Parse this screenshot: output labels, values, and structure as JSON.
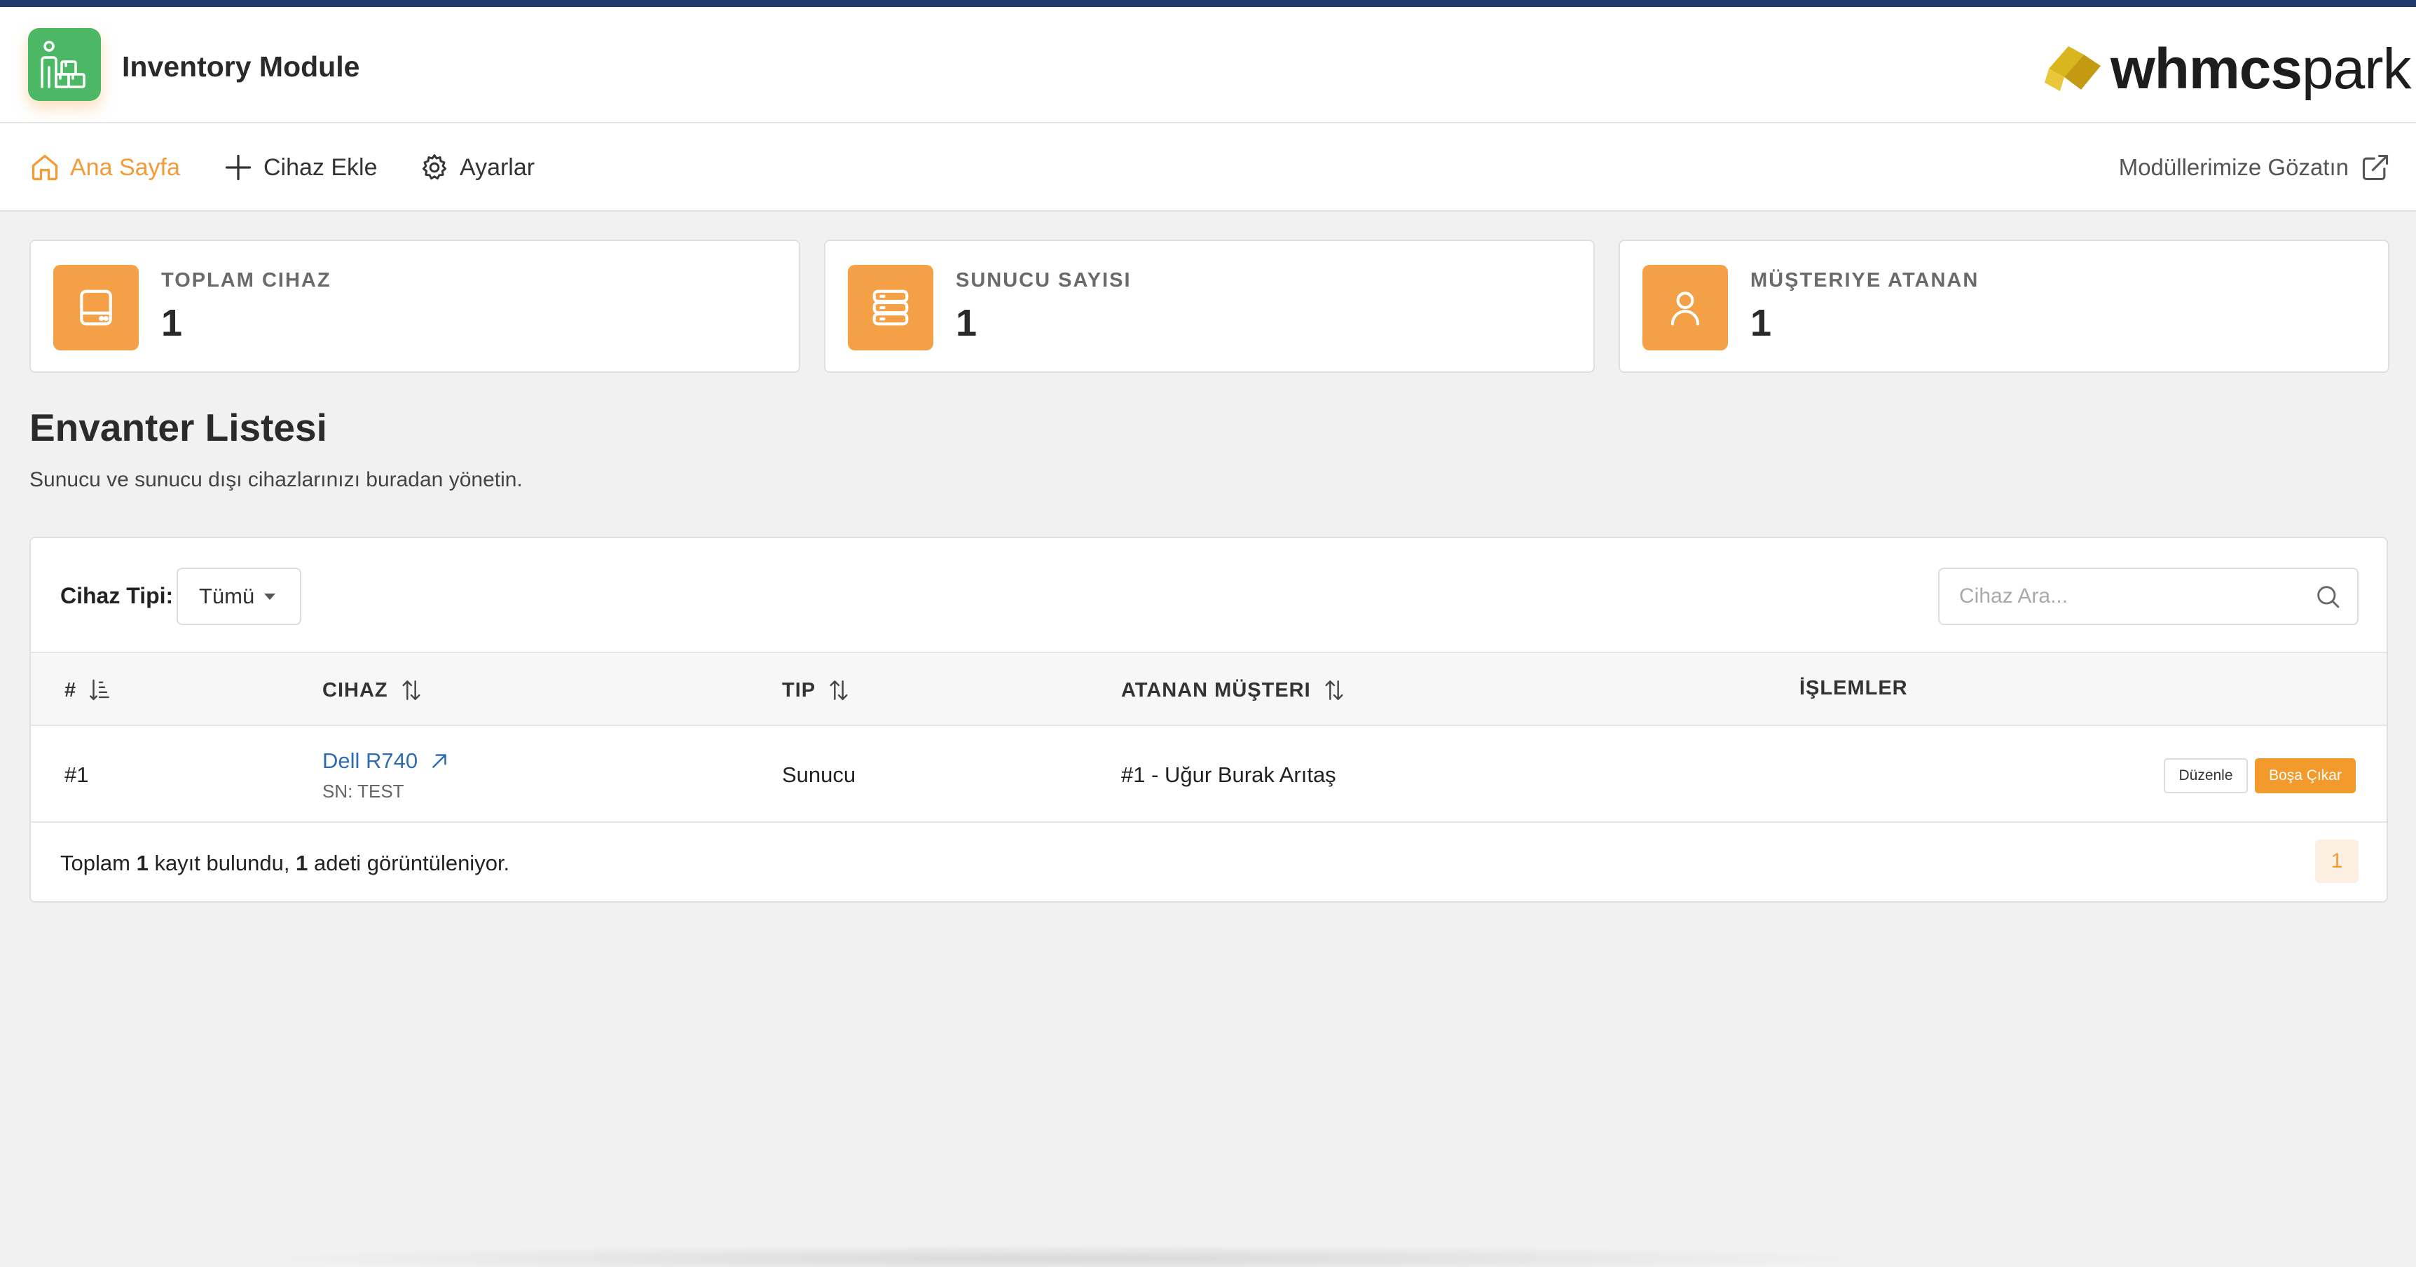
{
  "app": {
    "title": "Inventory Module",
    "brand_bold": "whmcs",
    "brand_light": "park"
  },
  "nav": {
    "items": [
      {
        "label": "Ana Sayfa",
        "icon": "home-icon",
        "active": true
      },
      {
        "label": "Cihaz Ekle",
        "icon": "plus-icon",
        "active": false
      },
      {
        "label": "Ayarlar",
        "icon": "gear-icon",
        "active": false
      }
    ],
    "external_label": "Modüllerimize Gözatın",
    "external_icon": "external-link-icon"
  },
  "stats": [
    {
      "label": "TOPLAM CIHAZ",
      "value": "1",
      "icon": "device-icon"
    },
    {
      "label": "SUNUCU SAYISI",
      "value": "1",
      "icon": "server-icon"
    },
    {
      "label": "MÜŞTERIYE ATANAN",
      "value": "1",
      "icon": "user-icon"
    }
  ],
  "page": {
    "title": "Envanter Listesi",
    "subtitle": "Sunucu ve sunucu dışı cihazlarınızı buradan yönetin."
  },
  "filter": {
    "label": "Cihaz Tipi:",
    "selected": "Tümü"
  },
  "search": {
    "placeholder": "Cihaz Ara..."
  },
  "table": {
    "headers": [
      "#",
      "CIHAZ",
      "TIP",
      "ATANAN MÜŞTERI",
      "İŞLEMLER"
    ],
    "rows": [
      {
        "id": "#1",
        "device": "Dell R740",
        "serial": "SN: TEST",
        "type": "Sunucu",
        "customer": "#1 - Uğur Burak Arıtaş",
        "actions": [
          "Düzenle",
          "Boşa Çıkar"
        ]
      }
    ]
  },
  "footer": {
    "prefix": "Toplam",
    "total": "1",
    "middle": "kayıt bulundu,",
    "shown": "1",
    "suffix": "adeti görüntüleniyor.",
    "page": "1"
  },
  "colors": {
    "accent": "#f29b37",
    "app_icon_bg": "#4cb865",
    "link": "#2e6db4",
    "top_line": "#1f3a6b"
  }
}
